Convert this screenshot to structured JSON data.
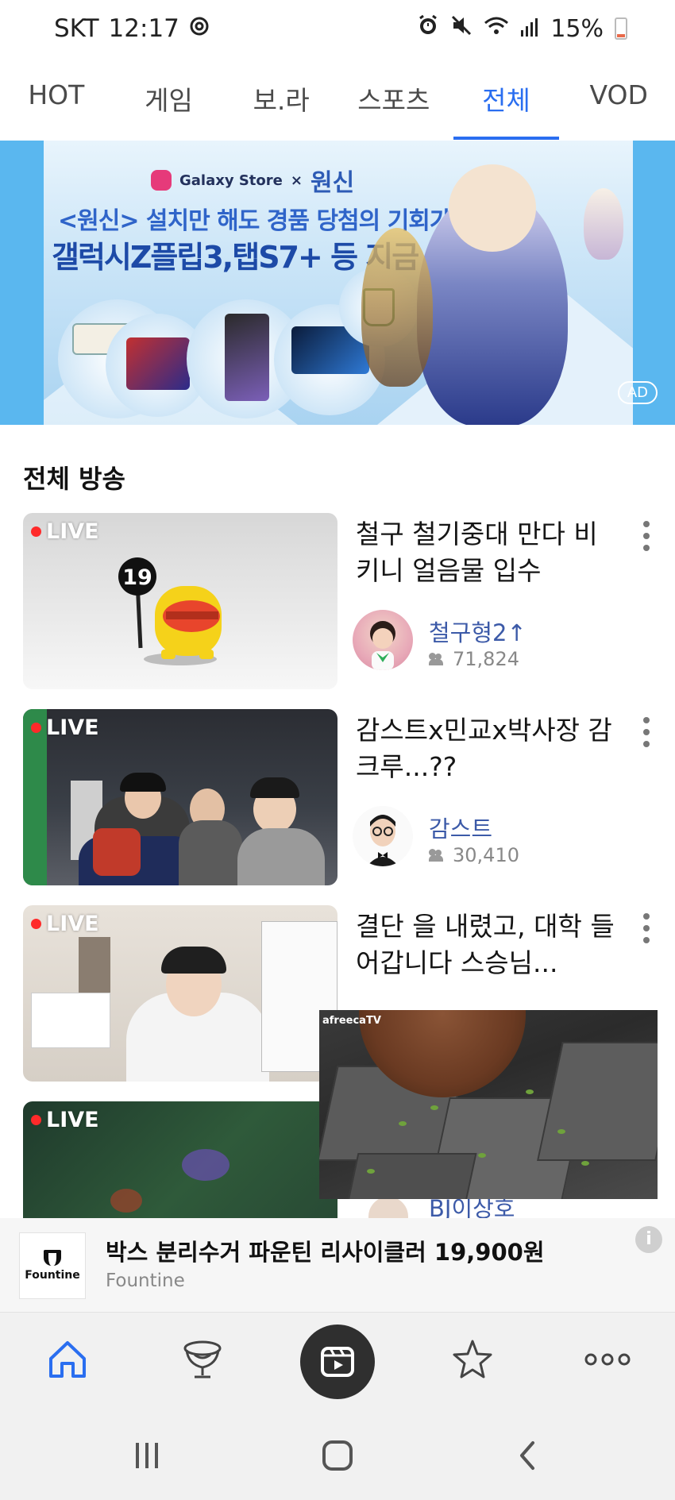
{
  "status_bar": {
    "carrier": "SKT",
    "time": "12:17",
    "battery": "15%",
    "battery_level": 0.15,
    "icons": [
      "sync-icon",
      "alarm-icon",
      "mute-icon",
      "wifi-icon",
      "signal-icon",
      "battery-icon"
    ]
  },
  "tabs": [
    {
      "label": "HOT",
      "active": false
    },
    {
      "label": "게임",
      "active": false
    },
    {
      "label": "보.라",
      "active": false
    },
    {
      "label": "스포츠",
      "active": false
    },
    {
      "label": "전체",
      "active": true
    },
    {
      "label": "VOD",
      "active": false
    }
  ],
  "banner": {
    "brand": "Galaxy Store",
    "cross": "×",
    "game": "원신",
    "line1": "<원신> 설치만 해도 경품 당첨의 기회가!",
    "line2": "갤럭시Z플립3,탭S7+ 등 지금 응모!",
    "badge": "AD"
  },
  "section": {
    "title": "전체 방송"
  },
  "live_label": "LIVE",
  "broadcasts": [
    {
      "title": "철구 철기중대 만다 비키니 얼음물 입수",
      "bj": "철구형2↑",
      "viewers": "71,824",
      "age_badge": "19"
    },
    {
      "title": "감스트x민교x박사장 감크루...??",
      "bj": "감스트",
      "viewers": "30,410"
    },
    {
      "title": "결단 을 내렸고, 대학 들어갑니다 스승님..."
    },
    {
      "bj_partial": "BJ이상호"
    }
  ],
  "miniplayer": {
    "logo": "afreecaTV"
  },
  "ad": {
    "logo_text": "Fountine",
    "title": "박스 분리수거 파운틴 리사이클러 19,900원",
    "advertiser": "Fountine",
    "info": "i"
  },
  "bottom_nav": [
    "home-icon",
    "trophy-icon",
    "live-broadcast-icon",
    "star-icon",
    "more-icon"
  ],
  "colors": {
    "accent": "#2a6ef0",
    "live": "#ff2a2a",
    "bj_name": "#3c5aa8"
  }
}
